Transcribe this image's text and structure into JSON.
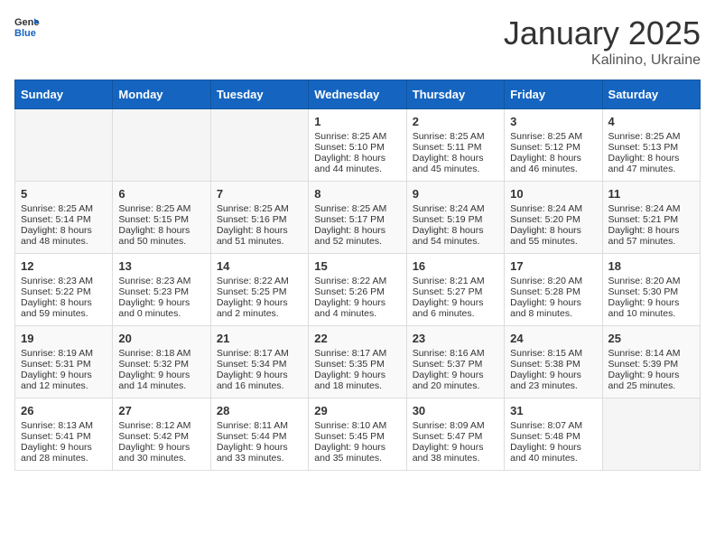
{
  "logo": {
    "general": "General",
    "blue": "Blue"
  },
  "header": {
    "month": "January 2025",
    "location": "Kalinino, Ukraine"
  },
  "weekdays": [
    "Sunday",
    "Monday",
    "Tuesday",
    "Wednesday",
    "Thursday",
    "Friday",
    "Saturday"
  ],
  "weeks": [
    [
      {
        "day": "",
        "sunrise": "",
        "sunset": "",
        "daylight": ""
      },
      {
        "day": "",
        "sunrise": "",
        "sunset": "",
        "daylight": ""
      },
      {
        "day": "",
        "sunrise": "",
        "sunset": "",
        "daylight": ""
      },
      {
        "day": "1",
        "sunrise": "Sunrise: 8:25 AM",
        "sunset": "Sunset: 5:10 PM",
        "daylight": "Daylight: 8 hours and 44 minutes."
      },
      {
        "day": "2",
        "sunrise": "Sunrise: 8:25 AM",
        "sunset": "Sunset: 5:11 PM",
        "daylight": "Daylight: 8 hours and 45 minutes."
      },
      {
        "day": "3",
        "sunrise": "Sunrise: 8:25 AM",
        "sunset": "Sunset: 5:12 PM",
        "daylight": "Daylight: 8 hours and 46 minutes."
      },
      {
        "day": "4",
        "sunrise": "Sunrise: 8:25 AM",
        "sunset": "Sunset: 5:13 PM",
        "daylight": "Daylight: 8 hours and 47 minutes."
      }
    ],
    [
      {
        "day": "5",
        "sunrise": "Sunrise: 8:25 AM",
        "sunset": "Sunset: 5:14 PM",
        "daylight": "Daylight: 8 hours and 48 minutes."
      },
      {
        "day": "6",
        "sunrise": "Sunrise: 8:25 AM",
        "sunset": "Sunset: 5:15 PM",
        "daylight": "Daylight: 8 hours and 50 minutes."
      },
      {
        "day": "7",
        "sunrise": "Sunrise: 8:25 AM",
        "sunset": "Sunset: 5:16 PM",
        "daylight": "Daylight: 8 hours and 51 minutes."
      },
      {
        "day": "8",
        "sunrise": "Sunrise: 8:25 AM",
        "sunset": "Sunset: 5:17 PM",
        "daylight": "Daylight: 8 hours and 52 minutes."
      },
      {
        "day": "9",
        "sunrise": "Sunrise: 8:24 AM",
        "sunset": "Sunset: 5:19 PM",
        "daylight": "Daylight: 8 hours and 54 minutes."
      },
      {
        "day": "10",
        "sunrise": "Sunrise: 8:24 AM",
        "sunset": "Sunset: 5:20 PM",
        "daylight": "Daylight: 8 hours and 55 minutes."
      },
      {
        "day": "11",
        "sunrise": "Sunrise: 8:24 AM",
        "sunset": "Sunset: 5:21 PM",
        "daylight": "Daylight: 8 hours and 57 minutes."
      }
    ],
    [
      {
        "day": "12",
        "sunrise": "Sunrise: 8:23 AM",
        "sunset": "Sunset: 5:22 PM",
        "daylight": "Daylight: 8 hours and 59 minutes."
      },
      {
        "day": "13",
        "sunrise": "Sunrise: 8:23 AM",
        "sunset": "Sunset: 5:23 PM",
        "daylight": "Daylight: 9 hours and 0 minutes."
      },
      {
        "day": "14",
        "sunrise": "Sunrise: 8:22 AM",
        "sunset": "Sunset: 5:25 PM",
        "daylight": "Daylight: 9 hours and 2 minutes."
      },
      {
        "day": "15",
        "sunrise": "Sunrise: 8:22 AM",
        "sunset": "Sunset: 5:26 PM",
        "daylight": "Daylight: 9 hours and 4 minutes."
      },
      {
        "day": "16",
        "sunrise": "Sunrise: 8:21 AM",
        "sunset": "Sunset: 5:27 PM",
        "daylight": "Daylight: 9 hours and 6 minutes."
      },
      {
        "day": "17",
        "sunrise": "Sunrise: 8:20 AM",
        "sunset": "Sunset: 5:28 PM",
        "daylight": "Daylight: 9 hours and 8 minutes."
      },
      {
        "day": "18",
        "sunrise": "Sunrise: 8:20 AM",
        "sunset": "Sunset: 5:30 PM",
        "daylight": "Daylight: 9 hours and 10 minutes."
      }
    ],
    [
      {
        "day": "19",
        "sunrise": "Sunrise: 8:19 AM",
        "sunset": "Sunset: 5:31 PM",
        "daylight": "Daylight: 9 hours and 12 minutes."
      },
      {
        "day": "20",
        "sunrise": "Sunrise: 8:18 AM",
        "sunset": "Sunset: 5:32 PM",
        "daylight": "Daylight: 9 hours and 14 minutes."
      },
      {
        "day": "21",
        "sunrise": "Sunrise: 8:17 AM",
        "sunset": "Sunset: 5:34 PM",
        "daylight": "Daylight: 9 hours and 16 minutes."
      },
      {
        "day": "22",
        "sunrise": "Sunrise: 8:17 AM",
        "sunset": "Sunset: 5:35 PM",
        "daylight": "Daylight: 9 hours and 18 minutes."
      },
      {
        "day": "23",
        "sunrise": "Sunrise: 8:16 AM",
        "sunset": "Sunset: 5:37 PM",
        "daylight": "Daylight: 9 hours and 20 minutes."
      },
      {
        "day": "24",
        "sunrise": "Sunrise: 8:15 AM",
        "sunset": "Sunset: 5:38 PM",
        "daylight": "Daylight: 9 hours and 23 minutes."
      },
      {
        "day": "25",
        "sunrise": "Sunrise: 8:14 AM",
        "sunset": "Sunset: 5:39 PM",
        "daylight": "Daylight: 9 hours and 25 minutes."
      }
    ],
    [
      {
        "day": "26",
        "sunrise": "Sunrise: 8:13 AM",
        "sunset": "Sunset: 5:41 PM",
        "daylight": "Daylight: 9 hours and 28 minutes."
      },
      {
        "day": "27",
        "sunrise": "Sunrise: 8:12 AM",
        "sunset": "Sunset: 5:42 PM",
        "daylight": "Daylight: 9 hours and 30 minutes."
      },
      {
        "day": "28",
        "sunrise": "Sunrise: 8:11 AM",
        "sunset": "Sunset: 5:44 PM",
        "daylight": "Daylight: 9 hours and 33 minutes."
      },
      {
        "day": "29",
        "sunrise": "Sunrise: 8:10 AM",
        "sunset": "Sunset: 5:45 PM",
        "daylight": "Daylight: 9 hours and 35 minutes."
      },
      {
        "day": "30",
        "sunrise": "Sunrise: 8:09 AM",
        "sunset": "Sunset: 5:47 PM",
        "daylight": "Daylight: 9 hours and 38 minutes."
      },
      {
        "day": "31",
        "sunrise": "Sunrise: 8:07 AM",
        "sunset": "Sunset: 5:48 PM",
        "daylight": "Daylight: 9 hours and 40 minutes."
      },
      {
        "day": "",
        "sunrise": "",
        "sunset": "",
        "daylight": ""
      }
    ]
  ]
}
